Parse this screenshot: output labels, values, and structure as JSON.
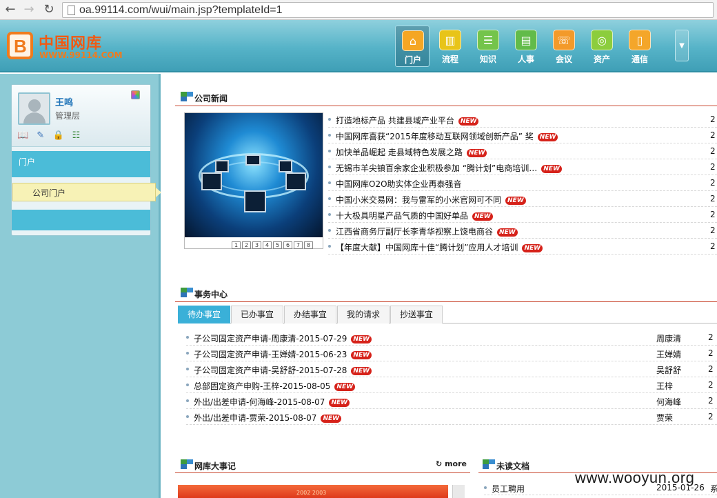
{
  "browser": {
    "url": "oa.99114.com/wui/main.jsp?templateId=1"
  },
  "header": {
    "logo_cn": "中国网库",
    "logo_url": "WWW.99114.COM",
    "nav": [
      {
        "label": "门户",
        "icon": "home-icon",
        "color": "#f5a623",
        "active": true
      },
      {
        "label": "流程",
        "icon": "chart-bars-icon",
        "color": "#e8c419",
        "active": false
      },
      {
        "label": "知识",
        "icon": "database-icon",
        "color": "#74c44b",
        "active": false
      },
      {
        "label": "人事",
        "icon": "id-card-icon",
        "color": "#62bb4a",
        "active": false
      },
      {
        "label": "会议",
        "icon": "phone-icon",
        "color": "#f39a2a",
        "active": false
      },
      {
        "label": "资产",
        "icon": "coins-icon",
        "color": "#8ccd3d",
        "active": false
      },
      {
        "label": "通信",
        "icon": "mobile-icon",
        "color": "#f4a62a",
        "active": false
      }
    ]
  },
  "sidebar": {
    "user_name": "王鸣",
    "user_role": "管理层",
    "menu_head": "门户",
    "menu_item": "公司门户"
  },
  "news": {
    "title": "公司新闻",
    "pager": [
      "1",
      "2",
      "3",
      "4",
      "5",
      "6",
      "7",
      "8"
    ],
    "items": [
      {
        "text": "打造地标产品 共建县域产业平台",
        "new": true,
        "date": "2"
      },
      {
        "text": "中国网库喜获“2015年度移动互联网领域创新产品” 奖",
        "new": true,
        "date": "2"
      },
      {
        "text": "加快单品崛起 走县域特色发展之路",
        "new": true,
        "date": "2"
      },
      {
        "text": "无锡市羊尖镇百余家企业积极参加 “腾计划”电商培训…",
        "new": true,
        "date": "2"
      },
      {
        "text": "中国网库O2O助实体企业再泰强音",
        "new": false,
        "date": "2"
      },
      {
        "text": "中国小米交易网：我与雷军的小米官网可不同",
        "new": true,
        "date": "2"
      },
      {
        "text": "十大极具明星产品气质的中国好单品",
        "new": true,
        "date": "2"
      },
      {
        "text": "江西省商务厅副厅长李青华视察上饶电商谷",
        "new": true,
        "date": "2"
      },
      {
        "text": "【年度大献】中国网库十佳“腾计划”应用人才培训",
        "new": true,
        "date": "2"
      }
    ],
    "badge": "NEW"
  },
  "affairs": {
    "title": "事务中心",
    "tabs": [
      "待办事宜",
      "已办事宜",
      "办结事宜",
      "我的请求",
      "抄送事宜"
    ],
    "items": [
      {
        "text": "子公司固定资产申请-周康清-2015-07-29",
        "person": "周康清",
        "date": "2"
      },
      {
        "text": "子公司固定资产申请-王婵婧-2015-06-23",
        "person": "王婵婧",
        "date": "2"
      },
      {
        "text": "子公司固定资产申请-吴舒舒-2015-07-28",
        "person": "吴舒舒",
        "date": "2"
      },
      {
        "text": "总部固定资产申购-王梓-2015-08-05",
        "person": "王梓",
        "date": "2"
      },
      {
        "text": "外出/出差申请-何海峰-2015-08-07",
        "person": "何海峰",
        "date": "2"
      },
      {
        "text": "外出/出差申请-贾荣-2015-08-07",
        "person": "贾荣",
        "date": "2"
      }
    ]
  },
  "events": {
    "title": "网库大事记",
    "more": "more",
    "img_years": "2002    2003"
  },
  "unread": {
    "title": "未读文档",
    "item": "员工聘用",
    "date": "2015-01-26",
    "extra": "系"
  },
  "watermark": "www.wooyun.org"
}
